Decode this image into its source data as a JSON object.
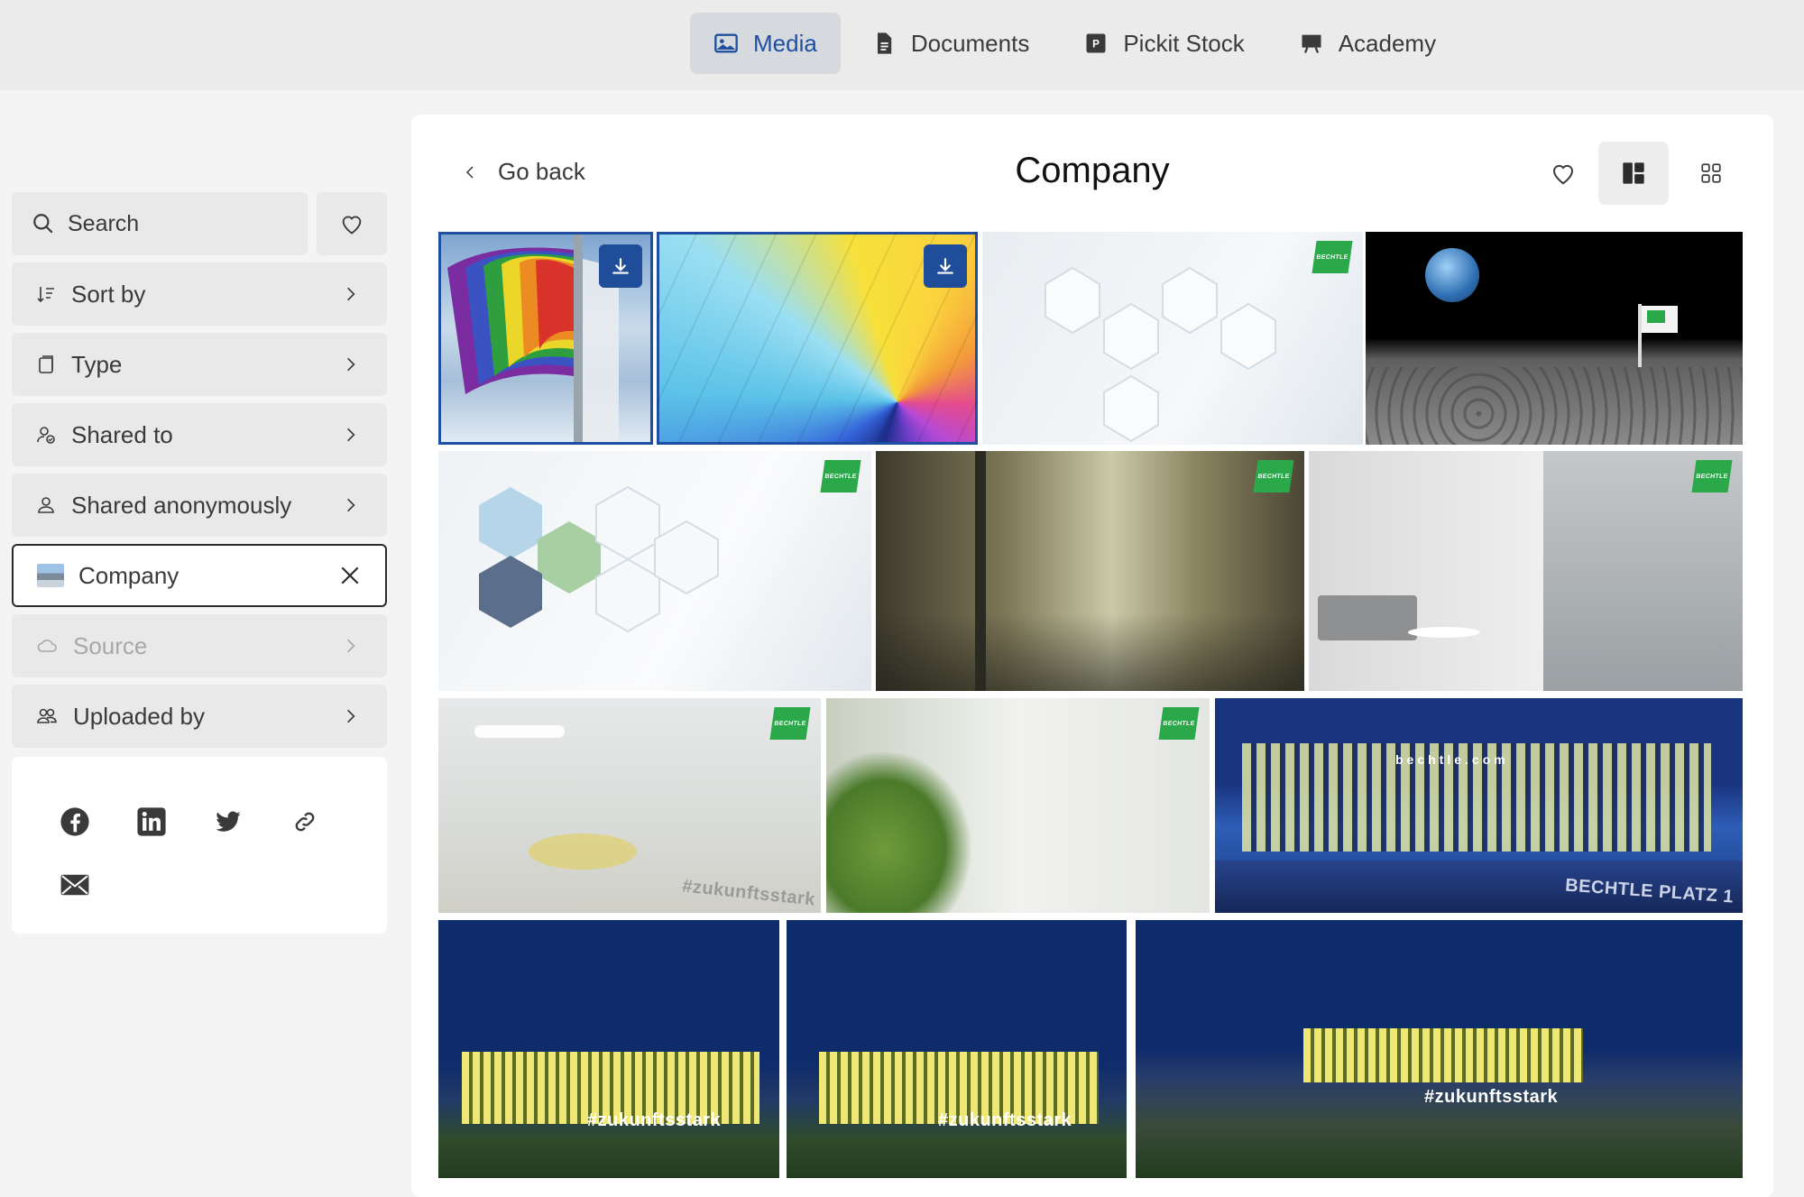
{
  "nav": {
    "tabs": [
      {
        "label": "Media",
        "icon": "image-icon",
        "active": true
      },
      {
        "label": "Documents",
        "icon": "document-icon",
        "active": false
      },
      {
        "label": "Pickit Stock",
        "icon": "stock-icon",
        "active": false
      },
      {
        "label": "Academy",
        "icon": "academy-icon",
        "active": false
      }
    ]
  },
  "sidebar": {
    "search_label": "Search",
    "filters": [
      {
        "label": "Sort by",
        "icon": "sort-icon"
      },
      {
        "label": "Type",
        "icon": "type-icon"
      },
      {
        "label": "Shared to",
        "icon": "shared-to-icon"
      },
      {
        "label": "Shared anonymously",
        "icon": "user-icon"
      },
      {
        "label": "Company",
        "icon": "collection-thumbnail",
        "selected": true
      },
      {
        "label": "Source",
        "icon": "cloud-icon",
        "disabled": true
      },
      {
        "label": "Uploaded by",
        "icon": "users-icon"
      }
    ],
    "share_icons": [
      "facebook-icon",
      "linkedin-icon",
      "twitter-icon",
      "link-icon",
      "email-icon"
    ]
  },
  "main": {
    "back_label": "Go back",
    "title": "Company",
    "tag_text": "#zukunftsstark",
    "building_sign": "bechtle.com",
    "street_sign": "BECHTLE PLATZ 1",
    "logo_text": "BECHTLE"
  },
  "colors": {
    "accent": "#1f4fa0",
    "brand_green": "#2aa84a",
    "selection": "#1d4fa3"
  }
}
